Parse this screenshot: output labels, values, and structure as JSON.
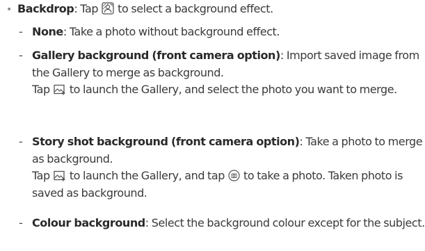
{
  "backdrop": {
    "title": "Backdrop",
    "sep": ":",
    "desc_before": " Tap ",
    "desc_after": " to select a background effect."
  },
  "items": [
    {
      "term": "None",
      "sep": ":",
      "desc": " Take a photo without background effect."
    },
    {
      "term": "Gallery background (front camera option)",
      "sep": ":",
      "desc": " Import saved image from the Gallery to merge as background.",
      "line2_before": "Tap ",
      "line2_after": " to launch the Gallery, and select the photo you want to merge."
    },
    {
      "term": "Story shot background (front camera option)",
      "sep": ":",
      "desc": " Take a photo to merge as background.",
      "line2_before": "Tap ",
      "line2_mid": " to launch the Gallery, and tap ",
      "line2_after": " to take a photo. Taken photo is saved as background."
    },
    {
      "term": "Colour background",
      "sep": ":",
      "desc": " Select the background colour except for the subject."
    }
  ],
  "icons": {
    "backdrop": "backdrop-icon",
    "gallery": "gallery-add-icon",
    "shutter": "camera-shutter-icon"
  },
  "colors": {
    "text": "#3a3a3a",
    "bold": "#2a2a2a"
  }
}
